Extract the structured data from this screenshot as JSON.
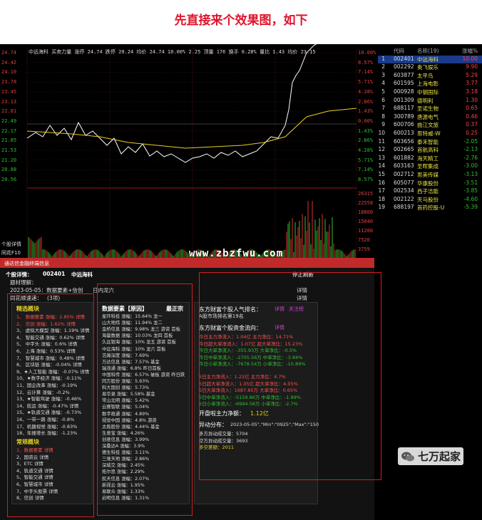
{
  "heading": "先直接来个效果图，如下",
  "chart": {
    "info": "中远海科  买卖力量  涨停 24.74 跌停 20.24 均价 24.74 10.00% 2.25 顶量 176 换手 0.28% 量比 1.43 均价 23.15",
    "left_labels": [
      "24.74",
      "24.42",
      "24.10",
      "23.78",
      "23.45",
      "23.13",
      "22.81",
      "22.49",
      "22.17",
      "21.85",
      "21.53",
      "21.20",
      "20.88",
      "20.56"
    ],
    "right_labels": [
      "10.00%",
      "8.57%",
      "7.14%",
      "5.71%",
      "4.28%",
      "2.86%",
      "1.43%",
      "0.00%",
      "1.43%",
      "2.86%",
      "4.28%",
      "5.71%",
      "7.14%",
      "8.57%"
    ],
    "vol_labels": [
      "26315",
      "22558",
      "18800",
      "15040",
      "11280",
      "7520",
      "3759"
    ],
    "vol_left": "个股详情",
    "vol_left2": "同花F10"
  },
  "stock_list": {
    "headers": [
      "代码",
      "名称(19)",
      "涨幅%"
    ],
    "rows": [
      {
        "idx": "1",
        "code": "002401",
        "name": "中远海科",
        "chg": "10.00",
        "up": true
      },
      {
        "idx": "2",
        "code": "002292",
        "name": "奥飞娱乐",
        "chg": "9.90",
        "up": true
      },
      {
        "idx": "3",
        "code": "603877",
        "name": "太平鸟",
        "chg": "5.29",
        "up": true
      },
      {
        "idx": "4",
        "code": "601595",
        "name": "上海电影",
        "chg": "3.77",
        "up": true
      },
      {
        "idx": "5",
        "code": "000928",
        "name": "中钢国际",
        "chg": "3.18",
        "up": true
      },
      {
        "idx": "6",
        "code": "001309",
        "name": "德明利",
        "chg": "1.30",
        "up": true
      },
      {
        "idx": "7",
        "code": "688117",
        "name": "圣诺生物",
        "chg": "0.65",
        "up": true
      },
      {
        "idx": "8",
        "code": "300789",
        "name": "唐源电气",
        "chg": "0.46",
        "up": true
      },
      {
        "idx": "9",
        "code": "600706",
        "name": "曲江文旅",
        "chg": "0.37",
        "up": true
      },
      {
        "idx": "10",
        "code": "600213",
        "name": "思特威-W",
        "chg": "0.25",
        "up": true
      },
      {
        "idx": "11",
        "code": "603656",
        "name": "泰禾智能",
        "chg": "-2.05",
        "up": false
      },
      {
        "idx": "12",
        "code": "002665",
        "name": "首航高科",
        "chg": "-2.13",
        "up": false
      },
      {
        "idx": "13",
        "code": "601882",
        "name": "海天精工",
        "chg": "-2.76",
        "up": false
      },
      {
        "idx": "14",
        "code": "603163",
        "name": "圣晖集成",
        "chg": "-3.00",
        "up": false
      },
      {
        "idx": "15",
        "code": "002712",
        "name": "思美传媒",
        "chg": "-3.13",
        "up": false
      },
      {
        "idx": "16",
        "code": "605077",
        "name": "华康股份",
        "chg": "-3.51",
        "up": false
      },
      {
        "idx": "17",
        "code": "002534",
        "name": "西子洁能",
        "chg": "-3.85",
        "up": false
      },
      {
        "idx": "18",
        "code": "002122",
        "name": "天马股份",
        "chg": "-4.60",
        "up": false
      },
      {
        "idx": "19",
        "code": "688197",
        "name": "首药控股-U",
        "chg": "-5.39",
        "up": false
      }
    ]
  },
  "window": {
    "title": "通达信金融终端信息",
    "stock_label": "个股详情：",
    "stock_code": "002401",
    "stock_name": "中远海科",
    "close_label": "停止刷新",
    "meta1": "题材理解：",
    "date_line": "2023-05-05：数据要素+信创",
    "intraday": "日内龙六",
    "f10": "同花顺速递：",
    "f10_count": "(3项)",
    "detail1": "详情",
    "detail2": "详情",
    "panel1_title": "精选概块",
    "panel1_rows": [
      "1、 数据要素 涨幅：2.85%    详情",
      "2、 信创 涨幅：1.62%    详情",
      "3、 虚拟大模型 涨幅：1.19%    详情",
      "4、 智能交通 涨幅：0.62%    详情",
      "5、 中字头 涨幅：0.6%    详情",
      "6、 上海 涨幅：0.53%    详情",
      "7、 智慧城市 涨幅：0.48%    详情",
      "8、 区块链 涨幅：-0.04%    详情",
      "9、★人工智能 涨幅：-0.07%    详情",
      "10、★数字经济 涨幅：-0.11%",
      "11、国企改革 涨幅：-0.19%",
      "12、云计算 涨幅：-0.2%",
      "13、★智能驾驶 涨幅：-0.46%",
      "14、航运 涨幅：-0.47%    详情",
      "15、★轨道交通 涨幅：-0.73%",
      "16、一带一路 涨幅：-0.8%",
      "17、机器视觉 涨幅：-0.83%",
      "18、年报增长 涨幅：-1.23%"
    ],
    "panel1b_title": "常规概块",
    "panel1b_rows": [
      "1、数据要素    详情",
      "2、国资云    详情",
      "3、ETC    详情",
      "4、轨道交通    详情",
      "5、智能交通    详情",
      "6、智慧城市    详情",
      "7、中字头股票    详情",
      "8、信创    详情"
    ],
    "panel2_title": "数据要素【原因】",
    "panel2_title2": "最正宗",
    "panel2_rows": [
      "星环科技 涨幅：15.64% 龙一",
      "山大地纬 涨幅：11.94% 龙二",
      "金桥信息 涨幅：9.98% 龙三 游资 首板",
      "海量数据 涨幅：10.03% 龙四 首板",
      "久远银海 涨幅：10% 龙五 游资 首板",
      "中远海科 涨幅：10% 龙六 首板",
      "浩瀚深度 涨幅：7.69%",
      "万达信息 涨幅：7.57% 基金",
      "瑞茂通 涨幅：6.8% 昨日首板",
      "中国科传 涨幅：6.57% 破板 游资 昨日跌",
      "同方股份 涨幅：5.93%",
      "科大国创 涨幅：5.73%",
      "易华录 涨幅：5.58% 基金",
      "常山北明 涨幅：5.42%",
      "云赛智联 涨幅：5.04%",
      "数字政通 涨幅：4.89%",
      "视觉中国 涨幅：4.8% 游资",
      "太极股份 涨幅：4.44% 基金",
      "生意宝 涨幅：4.26%",
      "创意信息 涨幅：3.99%",
      "深桑达A 涨幅：3.9%",
      "德生科技 涨幅：3.11%",
      "三维天地 涨幅：2.86%",
      "深城交 涨幅：2.45%",
      "拓尔思 涨幅：2.29%",
      "航天信息 涨幅：2.07%",
      "新视云 涨幅：1.95%",
      "易联众 涨幅：1.33%",
      "启明信息 涨幅：1.31%"
    ],
    "panel3_pop_title": "东方财富个股人气排名：",
    "panel3_pop_a": "详情",
    "panel3_pop_b": "关注榜",
    "panel3_pop_line": "A股市场排名第19名",
    "panel3_flow_title": "东方财富个股资金流向：",
    "panel3_flow_a": "详情",
    "panel3_flow_rows": [
      "今日主力净流入：1.04亿 主力净比：14.71%",
      "今日超大单净流入：1.07亿 超大单净比：15.23%",
      "今日大单净流入：-355.93万 大单净比：-0.5%",
      "今日中单净流入：-2705.56万 中单净比：-3.84%",
      "今日小单净流入：-7678.54万 小单净比：-10.89%"
    ],
    "panel3_flow5_rows": [
      "5日主力净流入：1.22亿 主力净比：4.7%",
      "5日超大单净流入：1.05亿 超大单净比：4.05%",
      "5日大单净流入：1687.85万 大单净比：0.65%",
      "5日中单净流入：-5159.86万 中单净比：-1.99%",
      "5日小单净流入：-6994.58万 小单净比：-2.7%"
    ],
    "panel3_open": "开盘啦主力净额：",
    "panel3_open_val": "1.12亿",
    "panel3_dist_title": "异动分布：",
    "panel3_dist_val": "2023-05-05\",\"Min\":\"0925\",\"Max\":\"150",
    "panel3_dist_rows": [
      "多方异动成交量：5704",
      "空方异动成交量：3693",
      "多空差额：2011"
    ]
  },
  "watermark": "www.zbzfwu.com",
  "logo_text": "七万起家",
  "colors": {
    "red": "#e0142b",
    "up": "#ff4040",
    "down": "#30c030",
    "yellow": "#e8e040",
    "frame": "#d02020"
  }
}
